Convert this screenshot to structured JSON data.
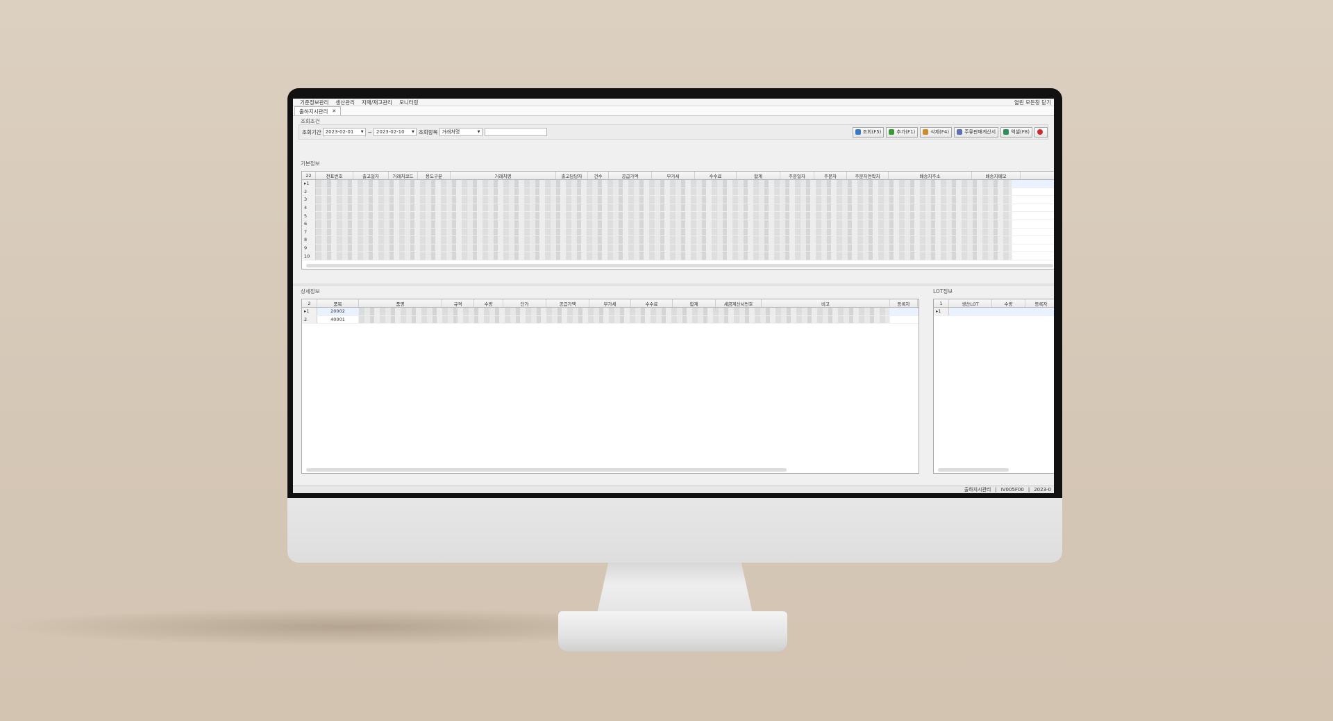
{
  "menu": {
    "items": [
      "기준정보관리",
      "생산관리",
      "자재/재고관리",
      "모니터링"
    ],
    "close_all": "열린 모든창 닫기"
  },
  "tab": {
    "label": "출하지시관리",
    "close": "✕"
  },
  "search_section": {
    "title": "조회조건"
  },
  "search": {
    "period_label": "조회기간",
    "date_from": "2023-02-01",
    "separator": "~",
    "date_to": "2023-02-10",
    "item_label": "조회항목",
    "item_value": "거래처명",
    "keyword": ""
  },
  "toolbar": {
    "search": "조회(F5)",
    "add": "추가(F1)",
    "delete": "삭제(F4)",
    "invoice": "주류판매계산서",
    "excel": "엑셀(F8)"
  },
  "colors": {
    "search": "#3b78c9",
    "add": "#3a9a3a",
    "delete": "#d18a2a",
    "invoice": "#5a6fb5",
    "excel": "#2f8f5a",
    "close": "#cc2a2a"
  },
  "main_grid": {
    "title": "기본정보",
    "count": "22",
    "columns": [
      "전표번호",
      "출고일자",
      "거래처코드",
      "용도구분",
      "거래처명",
      "출고담당자",
      "건수",
      "공급가액",
      "부가세",
      "수수료",
      "합계",
      "주문일자",
      "주문자",
      "주문자연락처",
      "배송지주소",
      "배송지메모"
    ],
    "rows": [
      "1",
      "2",
      "3",
      "4",
      "5",
      "6",
      "7",
      "8",
      "9",
      "10"
    ]
  },
  "detail_grid": {
    "title": "상세정보",
    "count": "2",
    "columns": [
      "품목",
      "품명",
      "규격",
      "수량",
      "단가",
      "공급가액",
      "부가세",
      "수수료",
      "합계",
      "세금계산서번호",
      "비고",
      "등록자"
    ],
    "rows": [
      {
        "n": "1",
        "item": "20002"
      },
      {
        "n": "2",
        "item": "40001"
      }
    ]
  },
  "lot_grid": {
    "title": "LOT정보",
    "count": "1",
    "columns": [
      "생산LOT",
      "수량",
      "등록자"
    ],
    "rows": [
      "1"
    ]
  },
  "status": {
    "screen": "출하지시관리",
    "code": "IV005F00",
    "date": "2023-0"
  }
}
